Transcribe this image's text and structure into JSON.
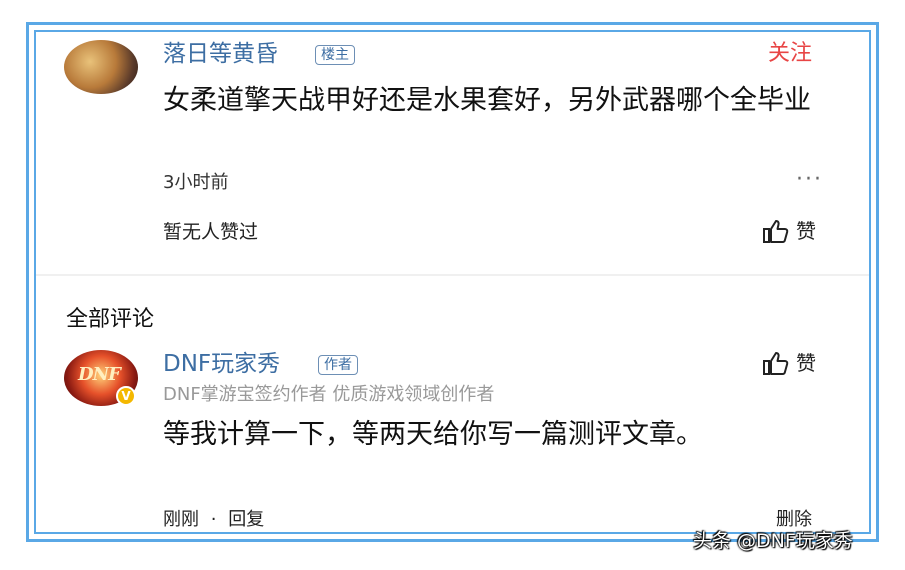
{
  "post": {
    "username": "落日等黄昏",
    "tag": "楼主",
    "follow_label": "关注",
    "text": "女柔道擎天战甲好还是水果套好，另外武器哪个全毕业",
    "time": "3小时前",
    "more_label": "···",
    "likes_text": "暂无人赞过",
    "like_label": "赞"
  },
  "comments_section": {
    "title": "全部评论"
  },
  "comment": {
    "username": "DNF玩家秀",
    "tag": "作者",
    "author_desc": "DNF掌游宝签约作者 优质游戏领域创作者",
    "like_label": "赞",
    "text": "等我计算一下，等两天给你写一篇测评文章。",
    "time": "刚刚",
    "separator": "·",
    "reply_label": "回复",
    "delete_label": "删除",
    "avatar_mark": "DNF",
    "vip_mark": "V"
  },
  "watermark": "头条 @DNF玩家秀",
  "colors": {
    "frame": "#5aa8e6",
    "username": "#3d6ea3",
    "follow": "#e84545",
    "meta_gray": "#999999"
  },
  "icons": {
    "like": "thumbs-up-icon",
    "more": "more-dots-icon",
    "vip": "verified-badge-icon"
  }
}
